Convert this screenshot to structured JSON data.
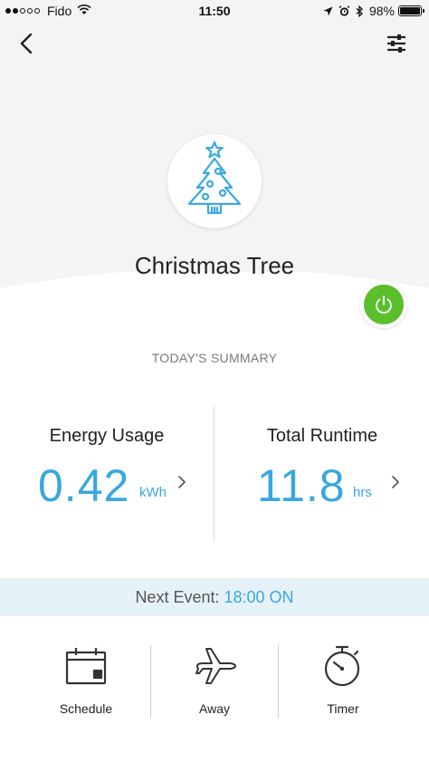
{
  "status_bar": {
    "carrier": "Fido",
    "time": "11:50",
    "battery_text": "98%",
    "battery_level": 0.98,
    "signal_dots_filled": 2,
    "signal_dots_total": 5
  },
  "nav": {
    "back_icon": "chevron-left-icon",
    "settings_icon": "sliders-icon"
  },
  "device": {
    "name": "Christmas Tree",
    "icon": "christmas-tree-icon",
    "power_state": "on",
    "power_color": "#5bbf2c"
  },
  "summary": {
    "label": "TODAY'S SUMMARY",
    "energy": {
      "title": "Energy Usage",
      "value": "0.42",
      "unit": "kWh"
    },
    "runtime": {
      "title": "Total Runtime",
      "value": "11.8",
      "unit": "hrs"
    }
  },
  "next_event": {
    "label": "Next Event:",
    "value": "18:00 ON"
  },
  "actions": [
    {
      "label": "Schedule",
      "icon": "calendar-icon"
    },
    {
      "label": "Away",
      "icon": "airplane-icon"
    },
    {
      "label": "Timer",
      "icon": "stopwatch-icon"
    }
  ],
  "colors": {
    "accent": "#39a8e0",
    "power_on": "#5bbf2c",
    "banner_bg": "#e6f1f8"
  }
}
